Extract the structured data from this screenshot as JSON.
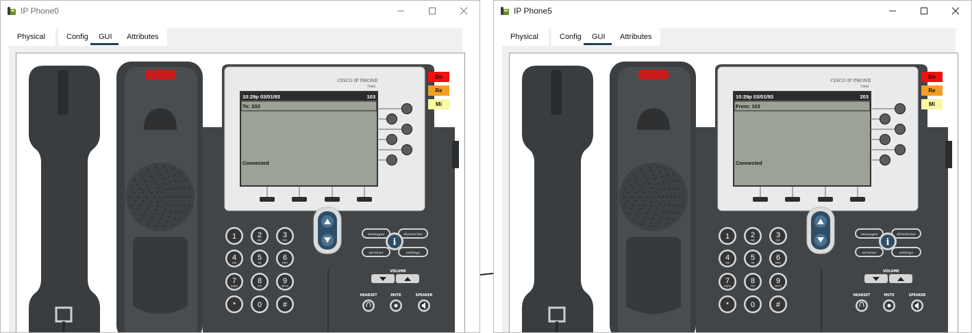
{
  "windows": [
    {
      "title": "IP Phone0",
      "tabs": [
        "Physical",
        "Config",
        "GUI",
        "Attributes"
      ],
      "active_tab": "GUI",
      "phone": {
        "brand": "CISCO IP PHONE",
        "model": "7960",
        "datetime": "10:29p 03/01/93",
        "line": "103",
        "peer": "To: 203",
        "status": "Connected",
        "badges": [
          "Do",
          "Re",
          "Mi"
        ]
      }
    },
    {
      "title": "IP Phone5",
      "tabs": [
        "Physical",
        "Config",
        "GUI",
        "Attributes"
      ],
      "active_tab": "GUI",
      "phone": {
        "brand": "CISCO IP PHONE",
        "model": "7960",
        "datetime": "10:29p 03/01/93",
        "line": "203",
        "peer": "From: 103",
        "status": "Connected",
        "badges": [
          "Do",
          "Re",
          "Mi"
        ]
      }
    }
  ],
  "keypad": [
    {
      "digit": "1",
      "letters": ""
    },
    {
      "digit": "2",
      "letters": "ABC"
    },
    {
      "digit": "3",
      "letters": "DEF"
    },
    {
      "digit": "4",
      "letters": "GHI"
    },
    {
      "digit": "5",
      "letters": "JKL"
    },
    {
      "digit": "6",
      "letters": "MNO"
    },
    {
      "digit": "7",
      "letters": "PQRS"
    },
    {
      "digit": "8",
      "letters": "TUV"
    },
    {
      "digit": "9",
      "letters": "WXYZ"
    },
    {
      "digit": "*",
      "letters": ""
    },
    {
      "digit": "0",
      "letters": ""
    },
    {
      "digit": "#",
      "letters": ""
    }
  ],
  "function_keys": {
    "messages": "messages",
    "directories": "directories",
    "services": "services",
    "settings": "settings",
    "info": "i",
    "volume": "VOLUME",
    "headset": "HEADSET",
    "mute": "MUTE",
    "speaker": "SPEAKER"
  },
  "colors": {
    "badge_do": "#ee1111",
    "badge_re": "#f0a020",
    "badge_mi": "#fbf7a2",
    "lcd": "#9ca396",
    "lcd_header": "#2b2b2b",
    "body": "#414548",
    "handset_light": "#cc1b1b",
    "tab_underline": "#1f3b57"
  },
  "icons": {
    "app": "ip-phone-app-icon",
    "minimize": "minimize-icon",
    "maximize": "maximize-icon",
    "close": "close-icon"
  }
}
